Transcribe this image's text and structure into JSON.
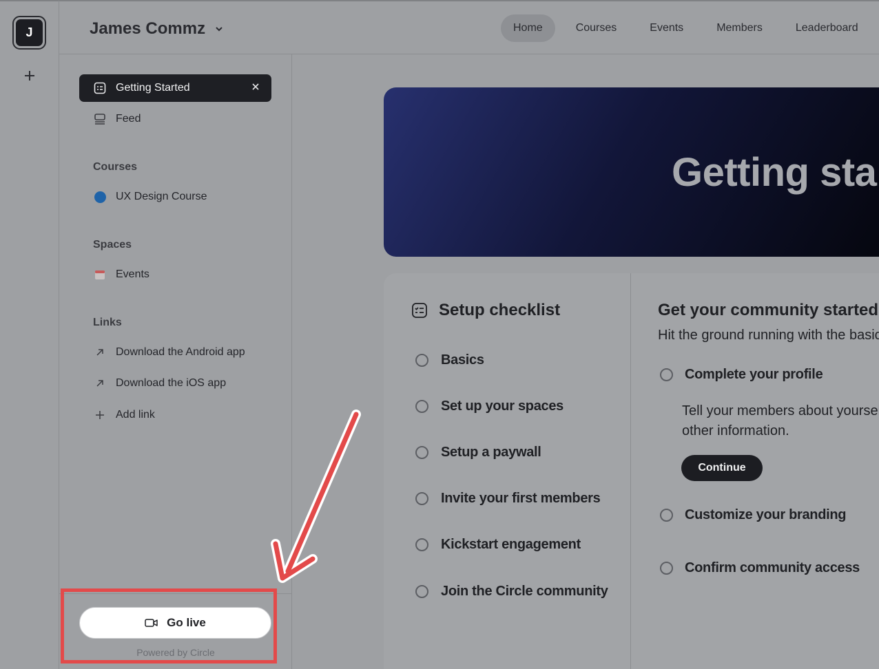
{
  "rail": {
    "avatar_letter": "J",
    "add_icon": "plus-icon"
  },
  "header": {
    "community_name": "James Commz",
    "nav": [
      {
        "label": "Home",
        "active": true
      },
      {
        "label": "Courses",
        "active": false
      },
      {
        "label": "Events",
        "active": false
      },
      {
        "label": "Members",
        "active": false
      },
      {
        "label": "Leaderboard",
        "active": false
      }
    ]
  },
  "sidebar": {
    "getting_started": "Getting Started",
    "feed": "Feed",
    "courses_heading": "Courses",
    "course_item": "UX Design Course",
    "spaces_heading": "Spaces",
    "events_item": "Events",
    "links_heading": "Links",
    "link_android": "Download the Android app",
    "link_ios": "Download the iOS app",
    "add_link": "Add link",
    "go_live": "Go live",
    "powered_by": "Powered by Circle"
  },
  "main": {
    "hero_title": "Getting started",
    "checklist_title": "Setup checklist",
    "checklist": [
      "Basics",
      "Set up your spaces",
      "Setup a paywall",
      "Invite your first members",
      "Kickstart engagement",
      "Join the Circle community"
    ],
    "right_title": "Get your community started",
    "right_subtitle": "Hit the ground running with the basics",
    "task_profile": "Complete your profile",
    "task_profile_desc_1": "Tell your members about yourself",
    "task_profile_desc_2": "other information.",
    "continue": "Continue",
    "task_branding": "Customize your branding",
    "task_access": "Confirm community access"
  },
  "colors": {
    "highlight": "#e34a4a",
    "hero_start": "#27306e",
    "hero_end": "#05060d"
  }
}
